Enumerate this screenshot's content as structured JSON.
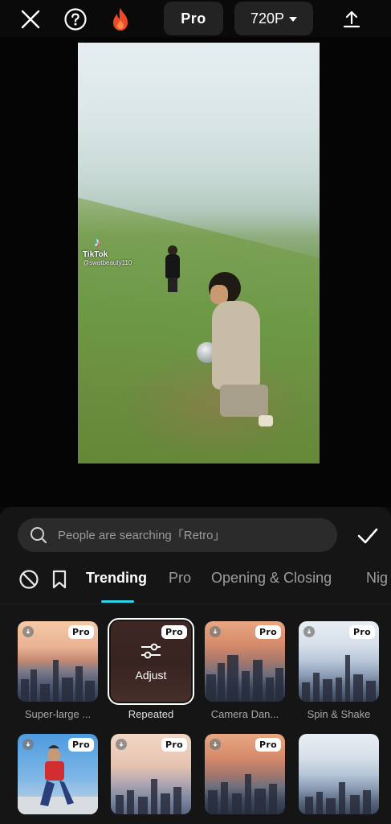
{
  "header": {
    "close_icon": "close-icon",
    "help_icon": "help-icon",
    "fire_icon": "fire-icon",
    "pro_label": "Pro",
    "resolution": "720P",
    "export_icon": "export-icon"
  },
  "preview": {
    "watermark_logo": "TikTok",
    "watermark_handle": "@swatbeauty110"
  },
  "controls": {
    "fullscreen_icon": "fullscreen-icon",
    "play_icon": "play-icon",
    "keyframe_icon": "keyframe-icon",
    "undo_icon": "undo-icon",
    "redo_icon": "redo-icon"
  },
  "search": {
    "placeholder": "People are searching「Retro」"
  },
  "tabs": {
    "none_icon": "no-effect-icon",
    "saved_icon": "bookmark-icon",
    "items": [
      "Trending",
      "Pro",
      "Opening & Closing",
      "Nig"
    ],
    "active": "Trending"
  },
  "effects": [
    {
      "label": "Super-large ...",
      "badge": "Pro"
    },
    {
      "label": "Repeated",
      "badge": "Pro",
      "overlay": "Adjust"
    },
    {
      "label": "Camera Dan...",
      "badge": "Pro"
    },
    {
      "label": "Spin & Shake",
      "badge": "Pro"
    },
    {
      "label": "",
      "badge": "Pro"
    },
    {
      "label": "",
      "badge": "Pro"
    },
    {
      "label": "",
      "badge": "Pro"
    },
    {
      "label": "",
      "badge": ""
    }
  ],
  "colors": {
    "accent": "#2fd1e6",
    "panel": "#151515",
    "fire": "#ee4a2a"
  }
}
